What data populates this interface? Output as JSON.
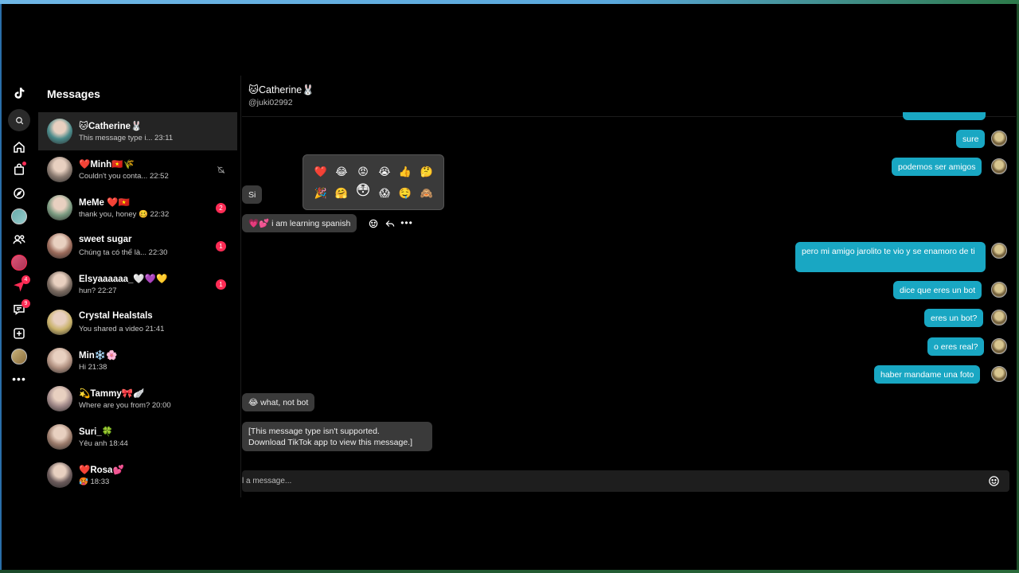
{
  "app": {
    "section_title": "Messages"
  },
  "rail": {
    "icons": [
      "tiktok-logo-icon",
      "search-icon",
      "home-icon",
      "shop-icon",
      "explore-icon",
      "profile-avatar",
      "following-icon",
      "live-avatar",
      "send-icon",
      "inbox-icon",
      "upload-icon",
      "me-avatar",
      "more-icon"
    ],
    "send_badge": "4",
    "inbox_badge": "9"
  },
  "conversations": [
    {
      "name": "🐱Catherine🐰",
      "preview": "This message type i...",
      "time": "23:11",
      "unread": "",
      "muted": false,
      "color": "#4a8a8a"
    },
    {
      "name": "❤️Minh🇻🇳🌾",
      "preview": "Couldn't you conta...",
      "time": "22:52",
      "unread": "",
      "muted": true,
      "color": "#8a7a70"
    },
    {
      "name": "MeMe ❤️🇻🇳",
      "preview": "thank you, honey 🥴",
      "time": "22:32",
      "unread": "2",
      "muted": false,
      "color": "#7a9a80"
    },
    {
      "name": "sweet sugar",
      "preview": "Chúng ta có thể là...",
      "time": "22:30",
      "unread": "1",
      "muted": false,
      "color": "#9a6a5a"
    },
    {
      "name": "Elsyaaaaaa_🤍💜💛",
      "preview": "hun?",
      "time": "22:27",
      "unread": "1",
      "muted": false,
      "color": "#7a6a60"
    },
    {
      "name": "Crystal Healstals",
      "preview": "You shared a video",
      "time": "21:41",
      "unread": "",
      "muted": false,
      "color": "#c9b26a"
    },
    {
      "name": "Min❄️🌸",
      "preview": "Hi",
      "time": "21:38",
      "unread": "",
      "muted": false,
      "color": "#b09080"
    },
    {
      "name": "💫Tammy🎀🪽",
      "preview": "Where are you from?",
      "time": "20:00",
      "unread": "",
      "muted": false,
      "color": "#a08888"
    },
    {
      "name": "Suri_🍀",
      "preview": "Yêu anh",
      "time": "18:44",
      "unread": "",
      "muted": false,
      "color": "#9a7a6a"
    },
    {
      "name": "❤️Rosa💕",
      "preview": "🥵",
      "time": "18:33",
      "unread": "",
      "muted": false,
      "color": "#6a5a5a"
    }
  ],
  "chat": {
    "name": "🐱Catherine🐰",
    "handle": "@juki02992",
    "reactions_row1": [
      "❤️",
      "😂",
      "😡",
      "😭",
      "👍",
      "🤔"
    ],
    "reactions_row2": [
      "🎉",
      "🤗",
      "😳",
      "😱",
      "🤤",
      "🙈"
    ],
    "messages": {
      "sure": "sure",
      "podemos": "podemos ser amigos",
      "si": "Si",
      "learning": "💗💕 i am learning spanish",
      "pero": "pero mi amigo jarolito te vio y se enamoro de ti",
      "dice": "dice que eres un bot",
      "eres_bot": "eres un bot?",
      "eres_real": "o eres real?",
      "haber": "haber mandame una foto",
      "what": "😂 what, not bot",
      "unsupported_line1": "[This message type isn't supported.",
      "unsupported_line2": "Download TikTok app to view this message.]"
    },
    "input_placeholder": "l a message..."
  },
  "colors": {
    "outgoing": "#19a7c3",
    "incoming": "#3a3a3a",
    "badge": "#fe2c55"
  }
}
